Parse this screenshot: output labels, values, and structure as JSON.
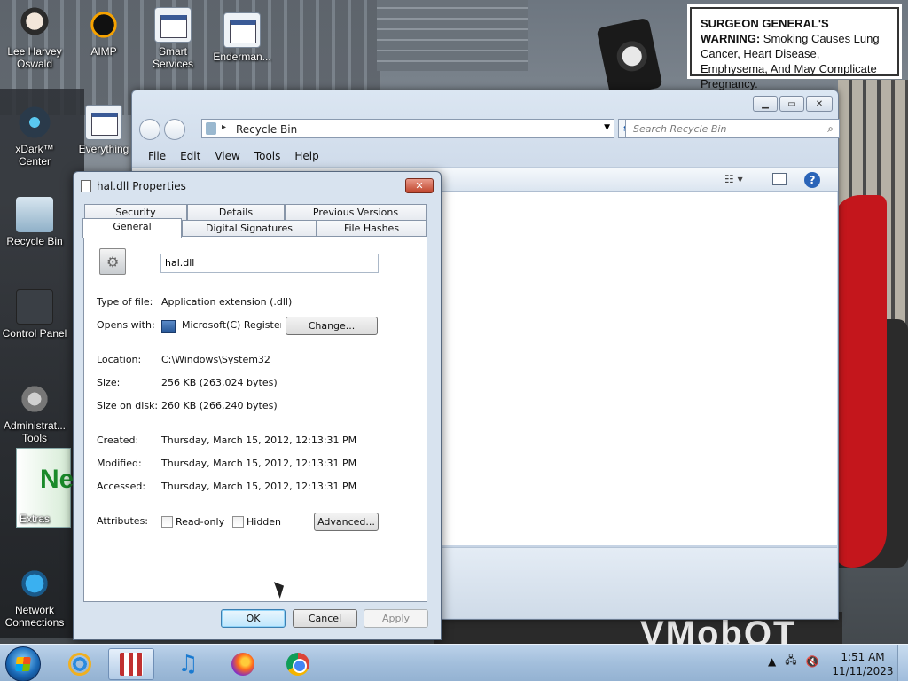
{
  "warning": {
    "head": "SURGEON GENERAL'S WARNING:",
    "body": "Smoking Causes Lung Cancer, Heart Disease, Emphysema, And May Complicate Pregnancy."
  },
  "desktop_icons": [
    {
      "label": "Lee Harvey Oswald",
      "icon": "person-icon"
    },
    {
      "label": "AIMP",
      "icon": "aimp-icon"
    },
    {
      "label": "Smart Services",
      "icon": "exe-icon"
    },
    {
      "label": "Enderman...",
      "icon": "exe-icon"
    },
    {
      "label": "xDark™ Center",
      "icon": "xdark-icon"
    },
    {
      "label": "Everything",
      "icon": "exe-icon"
    },
    {
      "label": "Recycle Bin",
      "icon": "recycle-bin-icon"
    },
    {
      "label": "Control Panel",
      "icon": "control-panel-icon"
    },
    {
      "label": "Administrat... Tools",
      "icon": "admin-tools-icon"
    },
    {
      "label": "Extras",
      "icon": "nero-icon"
    },
    {
      "label": "Network Connections",
      "icon": "network-icon"
    }
  ],
  "explorer": {
    "address": "Recycle Bin",
    "search_placeholder": "Search Recycle Bin",
    "menu": [
      "File",
      "Edit",
      "View",
      "Tools",
      "Help"
    ]
  },
  "dialog": {
    "title": "hal.dll Properties",
    "tabs_back": [
      "Security",
      "Details",
      "Previous Versions"
    ],
    "tabs_front": [
      "General",
      "Digital Signatures",
      "File Hashes"
    ],
    "file_name": "hal.dll",
    "type_label": "Type of file:",
    "type_value": "Application extension (.dll)",
    "opens_label": "Opens with:",
    "opens_value": "Microsoft(C) Register Se",
    "change_btn": "Change...",
    "location_label": "Location:",
    "location_value": "C:\\Windows\\System32",
    "size_label": "Size:",
    "size_value": "256 KB (263,024 bytes)",
    "size_disk_label": "Size on disk:",
    "size_disk_value": "260 KB (266,240 bytes)",
    "created_label": "Created:",
    "created_value": "Thursday, March 15, 2012, 12:13:31 PM",
    "modified_label": "Modified:",
    "modified_value": "Thursday, March 15, 2012, 12:13:31 PM",
    "accessed_label": "Accessed:",
    "accessed_value": "Thursday, March 15, 2012, 12:13:31 PM",
    "attributes_label": "Attributes:",
    "readonly_label": "Read-only",
    "hidden_label": "Hidden",
    "advanced_btn": "Advanced...",
    "ok_btn": "OK",
    "cancel_btn": "Cancel",
    "apply_btn": "Apply"
  },
  "taskbar": {
    "time": "1:51 AM",
    "date": "11/11/2023"
  },
  "bg_text": "VMobOT"
}
